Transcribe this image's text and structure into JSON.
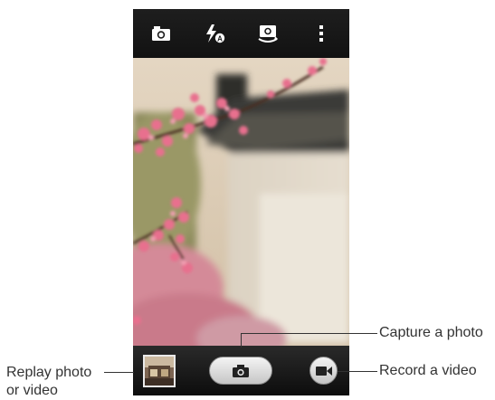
{
  "toolbar": {
    "icons": [
      "camera-mode-icon",
      "flash-auto-icon",
      "switch-camera-icon",
      "more-options-icon"
    ]
  },
  "viewfinder": {
    "content": "peach-blossom-scene"
  },
  "controls": {
    "thumbnail_icon": "gallery-thumbnail",
    "shutter_icon": "camera-icon",
    "video_icon": "video-camera-icon"
  },
  "annotations": {
    "replay": "Replay photo\nor video",
    "capture": "Capture a photo",
    "record": "Record a video"
  }
}
